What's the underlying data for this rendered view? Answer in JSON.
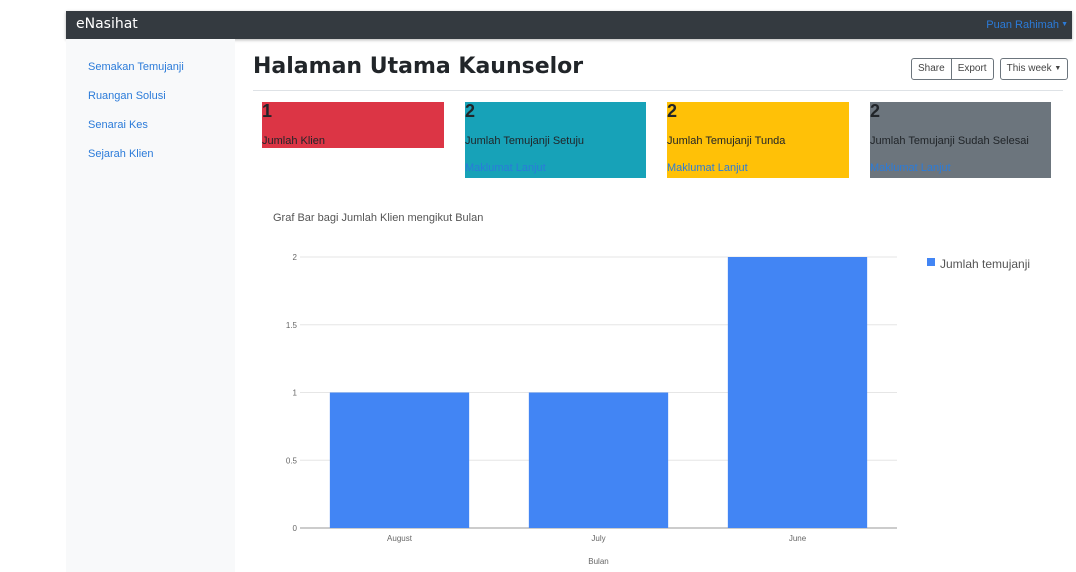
{
  "navbar": {
    "brand": "eNasihat",
    "user": "Puan Rahimah"
  },
  "sidebar": {
    "items": [
      {
        "label": "Semakan Temujanji"
      },
      {
        "label": "Ruangan Solusi"
      },
      {
        "label": "Senarai Kes"
      },
      {
        "label": "Sejarah Klien"
      }
    ]
  },
  "main": {
    "title": "Halaman Utama Kaunselor",
    "toolbar": {
      "share": "Share",
      "export": "Export",
      "range": "This week"
    },
    "cards": [
      {
        "count": "1",
        "label": "Jumlah Klien",
        "link": "",
        "color": "#dc3545"
      },
      {
        "count": "2",
        "label": "Jumlah Temujanji Setuju",
        "link": "Maklumat Lanjut",
        "color": "#17a2b8"
      },
      {
        "count": "2",
        "label": "Jumlah Temujanji Tunda",
        "link": "Maklumat Lanjut",
        "color": "#ffc107"
      },
      {
        "count": "2",
        "label": "Jumlah Temujanji Sudah Selesai",
        "link": "Maklumat Lanjut",
        "color": "#6c757d"
      }
    ]
  },
  "chart_data": {
    "type": "bar",
    "title": "Graf Bar bagi Jumlah Klien mengikut Bulan",
    "categories": [
      "August",
      "July",
      "June"
    ],
    "series": [
      {
        "name": "Jumlah temujanji",
        "values": [
          1,
          1,
          2
        ],
        "color": "#4285f4"
      }
    ],
    "xlabel": "Bulan",
    "ylabel": "",
    "ylim": [
      0,
      2
    ],
    "yticks": [
      "0",
      "0.5",
      "1",
      "1.5",
      "2"
    ],
    "grid": true,
    "legend": "right"
  }
}
